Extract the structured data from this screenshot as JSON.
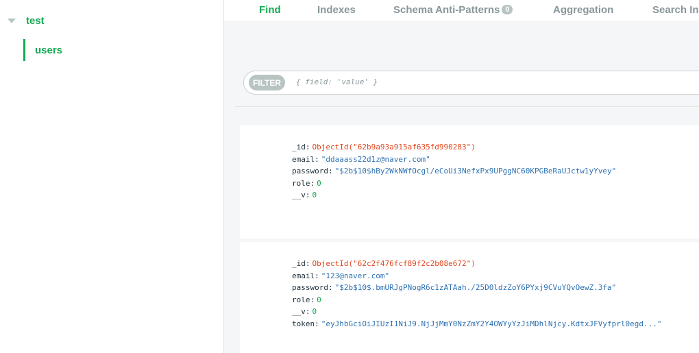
{
  "sidebar": {
    "database": "test",
    "collection": "users"
  },
  "tabs": {
    "find": "Find",
    "indexes": "Indexes",
    "schema": "Schema Anti-Patterns",
    "schema_badge": "0",
    "aggregation": "Aggregation",
    "search": "Search Ind"
  },
  "filter": {
    "chip": "FILTER",
    "placeholder": "{ field: 'value' }"
  },
  "documents": [
    {
      "id_key": "_id",
      "id_val": "ObjectId(\"62b9a93a915af635fd990283\")",
      "email_key": "email",
      "email_val": "\"ddaaass22d1z@naver.com\"",
      "password_key": "password",
      "password_val": "\"$2b$10$hBy2WkNWfOcgl/eCoUi3NefxPx9UPggNC60KPGBeRaUJctw1yYvey\"",
      "role_key": "role",
      "role_val": "0",
      "v_key": "__v",
      "v_val": "0"
    },
    {
      "id_key": "_id",
      "id_val": "ObjectId(\"62c2f476fcf89f2c2b08e672\")",
      "email_key": "email",
      "email_val": "\"123@naver.com\"",
      "password_key": "password",
      "password_val": "\"$2b$10$.bmURJgPNogR6c1zATAah./25D0ldzZoY6PYxj9CVuYQvOewZ.3fa\"",
      "role_key": "role",
      "role_val": "0",
      "v_key": "__v",
      "v_val": "0",
      "token_key": "token",
      "token_val": "\"eyJhbGciOiJIUzI1NiJ9.NjJjMmY0NzZmY2Y4OWYyYzJiMDhlNjcy.KdtxJFVyfprl0egd...\""
    }
  ],
  "colors": {
    "accent": "#13aa52",
    "objectid": "#e2461e",
    "string": "#2d71b3",
    "number": "#13aa52"
  }
}
